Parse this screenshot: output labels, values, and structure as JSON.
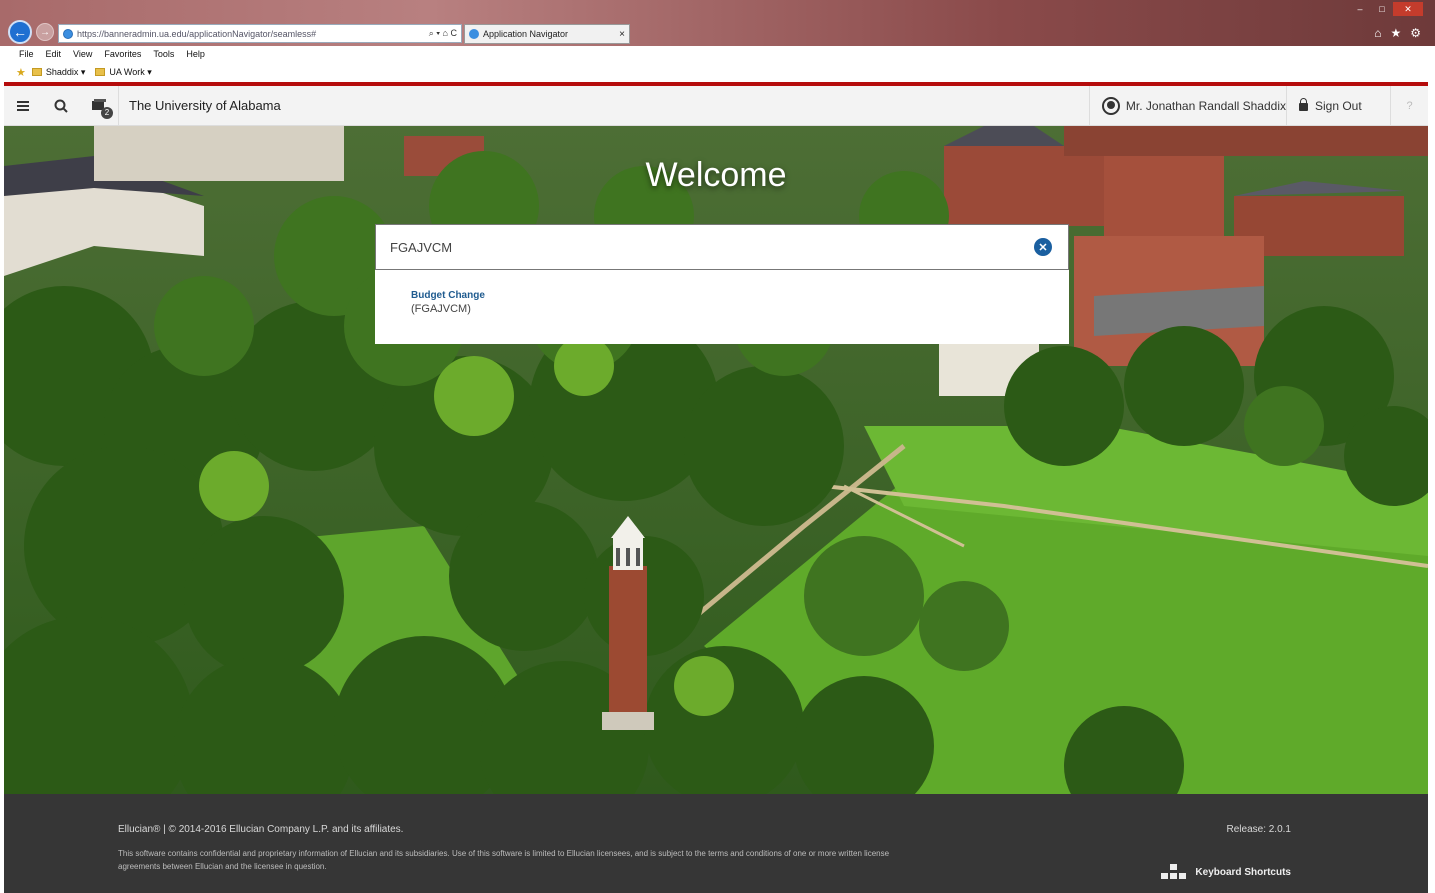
{
  "browser": {
    "url": "https://banneradmin.ua.edu/applicationNavigator/seamless#",
    "address_icons": "⌕ ▾ ⌂ C",
    "tab_title": "Application Navigator",
    "tab_close": "×",
    "menu": [
      "File",
      "Edit",
      "View",
      "Favorites",
      "Tools",
      "Help"
    ],
    "favorites": [
      "Shaddix ▾",
      "UA Work ▾"
    ]
  },
  "header": {
    "app_title": "The University of Alabama",
    "recent_badge": "2",
    "user_name": "Mr. Jonathan Randall Shaddix",
    "sign_out": "Sign Out",
    "help": "?"
  },
  "hero": {
    "welcome": "Welcome"
  },
  "search": {
    "value": "FGAJVCM",
    "results": [
      {
        "name": "Budget Change",
        "code": "(FGAJVCM)"
      }
    ]
  },
  "footer": {
    "copyright": "Ellucian® | © 2014-2016 Ellucian Company L.P. and its affiliates.",
    "legal": "This software contains confidential and proprietary information of Ellucian and its subsidiaries. Use of this software is limited to Ellucian licensees, and is subject to the terms and conditions of one or more written license agreements between Ellucian and the licensee in question.",
    "release": "Release: 2.0.1",
    "keyboard_shortcuts": "Keyboard Shortcuts"
  },
  "colors": {
    "accent_red": "#b50c0c",
    "footer_bg": "#363636",
    "result_link": "#1f5b8f",
    "clear_button": "#1a5fa0"
  }
}
